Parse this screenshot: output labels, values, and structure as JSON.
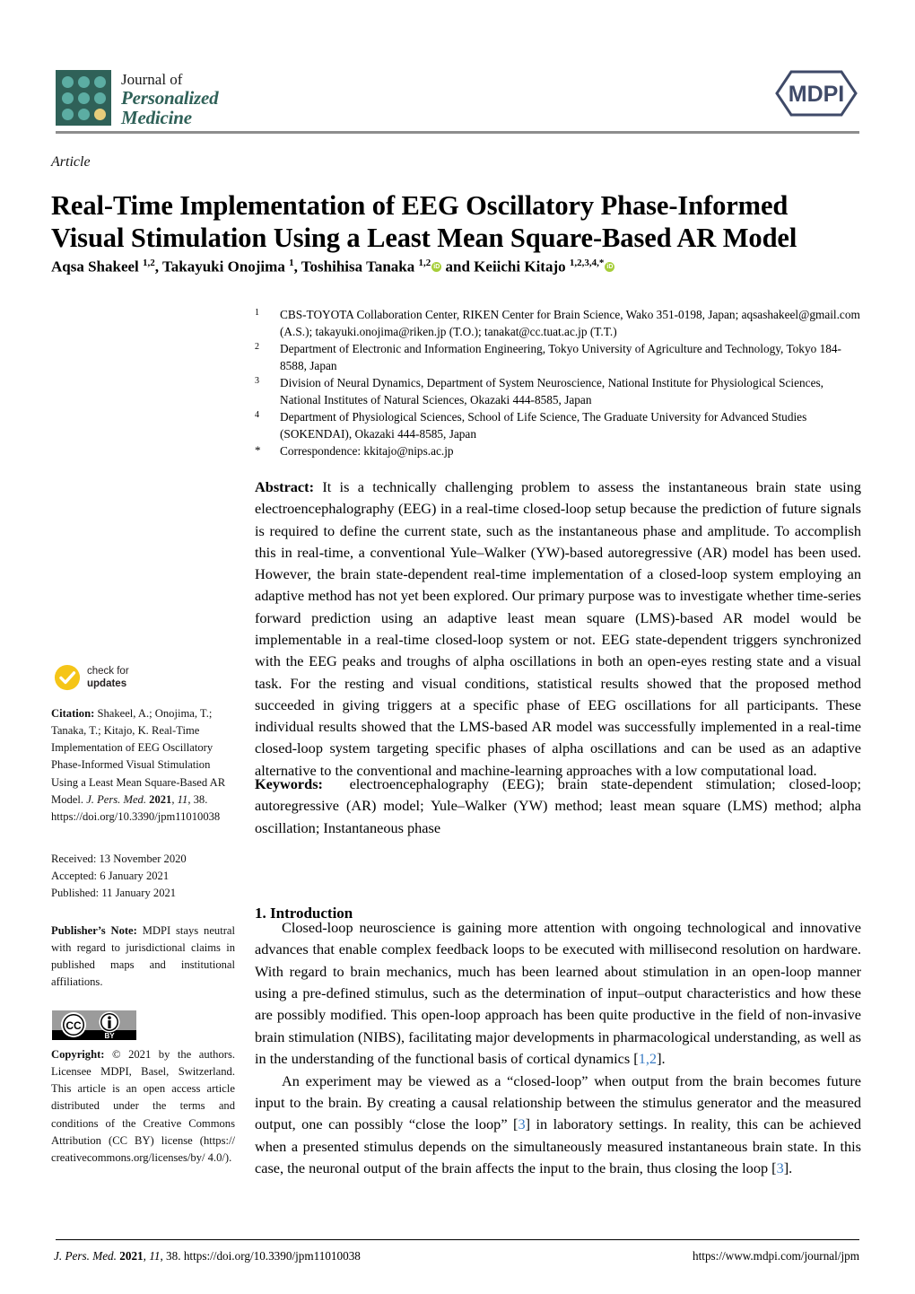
{
  "journal": {
    "logo_line1": "Journal of",
    "logo_line2": "Personalized",
    "logo_line3": "Medicine",
    "publisher_logo_text": "MDPI",
    "logo_square_color": "#2f6158",
    "logo_dot_color": "#5cada3",
    "logo_accent_dot_color": "#e7cd7b",
    "publisher_logo_color": "#3f4a68"
  },
  "article": {
    "type_label": "Article",
    "title": "Real-Time Implementation of EEG Oscillatory Phase-Informed Visual Stimulation Using a Least Mean Square-Based AR Model",
    "authors_html": "Aqsa Shakeel <sup>1,2</sup>, Takayuki Onojima <sup>1</sup>, Toshihisa Tanaka <sup>1,2</sup><span class=\"orcid\">iD</span> and Keiichi Kitajo <sup>1,2,3,4,*</sup><span class=\"orcid\">iD</span>",
    "orcid_color": "#a6ce39"
  },
  "affiliations": [
    {
      "marker": "1",
      "text": "CBS-TOYOTA Collaboration Center, RIKEN Center for Brain Science, Wako 351-0198, Japan; aqsashakeel@gmail.com (A.S.); takayuki.onojima@riken.jp (T.O.); tanakat@cc.tuat.ac.jp (T.T.)"
    },
    {
      "marker": "2",
      "text": "Department of Electronic and Information Engineering, Tokyo University of Agriculture and Technology, Tokyo 184-8588, Japan"
    },
    {
      "marker": "3",
      "text": "Division of Neural Dynamics, Department of System Neuroscience, National Institute for Physiological Sciences, National Institutes of Natural Sciences, Okazaki 444-8585, Japan"
    },
    {
      "marker": "4",
      "text": "Department of Physiological Sciences, School of Life Science, The Graduate University for Advanced Studies (SOKENDAI), Okazaki 444-8585, Japan"
    },
    {
      "marker": "*",
      "text": "Correspondence: kkitajo@nips.ac.jp"
    }
  ],
  "abstract": {
    "label": "Abstract:",
    "text": "It is a technically challenging problem to assess the instantaneous brain state using electroencephalography (EEG) in a real-time closed-loop setup because the prediction of future signals is required to define the current state, such as the instantaneous phase and amplitude. To accomplish this in real-time, a conventional Yule–Walker (YW)-based autoregressive (AR) model has been used. However, the brain state-dependent real-time implementation of a closed-loop system employing an adaptive method has not yet been explored. Our primary purpose was to investigate whether time-series forward prediction using an adaptive least mean square (LMS)-based AR model would be implementable in a real-time closed-loop system or not. EEG state-dependent triggers synchronized with the EEG peaks and troughs of alpha oscillations in both an open-eyes resting state and a visual task. For the resting and visual conditions, statistical results showed that the proposed method succeeded in giving triggers at a specific phase of EEG oscillations for all participants. These individual results showed that the LMS-based AR model was successfully implemented in a real-time closed-loop system targeting specific phases of alpha oscillations and can be used as an adaptive alternative to the conventional and machine-learning approaches with a low computational load."
  },
  "keywords": {
    "label": "Keywords:",
    "text": "electroencephalography (EEG); brain state-dependent stimulation; closed-loop; autoregressive (AR) model; Yule–Walker (YW) method; least mean square (LMS) method; alpha oscillation; Instantaneous phase"
  },
  "rail": {
    "check_for_updates_line1": "check for",
    "check_for_updates_line2": "updates",
    "check_badge_color": "#f5c518",
    "citation_label": "Citation:",
    "citation_text": "Shakeel, A.; Onojima, T.; Tanaka, T.; Kitajo, K. Real-Time Implementation of EEG Oscillatory Phase-Informed Visual Stimulation Using a Least Mean Square-Based AR Model.",
    "citation_journal": "J. Pers. Med.",
    "citation_year": "2021",
    "citation_volume": "11",
    "citation_article": "38.",
    "citation_doi": "https://doi.org/10.3390/jpm11010038",
    "received": "Received: 13 November 2020",
    "accepted": "Accepted: 6 January 2021",
    "published": "Published: 11 January 2021",
    "publisher_note_label": "Publisher’s Note:",
    "publisher_note_text": "MDPI stays neutral with regard to jurisdictional claims in published maps and institutional affiliations.",
    "copyright_label": "Copyright:",
    "copyright_text": "© 2021 by the authors. Licensee MDPI, Basel, Switzerland. This article is an open access article distributed under the terms and conditions of the Creative Commons Attribution (CC BY)  license (https:// creativecommons.org/licenses/by/ 4.0/).",
    "cc_license_text": "BY",
    "cc_mark_text": "CC"
  },
  "body": {
    "section_heading": "1. Introduction",
    "paragraph1_a": "Closed-loop neuroscience is gaining more attention with ongoing technological and innovative advances that enable complex feedback loops to be executed with millisecond resolution on hardware. With regard to brain mechanics, much has been learned about stimulation in an open-loop manner using a pre-defined stimulus, such as the determination of input–output characteristics and how these are possibly modified. This open-loop approach has been quite productive in the field of non-invasive brain stimulation (NIBS), facilitating major developments in pharmacological understanding, as well as in the understanding of the functional basis of cortical dynamics [",
    "paragraph1_ref": "1,2",
    "paragraph1_b": "].",
    "paragraph2_a": "An experiment may be viewed as a “closed-loop” when output from the brain becomes future input to the brain. By creating a causal relationship between the stimulus generator and the measured output, one can possibly “close the loop” [",
    "paragraph2_ref1": "3",
    "paragraph2_b": "] in laboratory settings. In reality, this can be achieved when a presented stimulus depends on the simultaneously measured instantaneous brain state. In this case, the neuronal output of the brain affects the input to the brain, thus closing the loop [",
    "paragraph2_ref2": "3",
    "paragraph2_c": "].",
    "reference_link_color": "#3a7cc4"
  },
  "footer": {
    "left_journal": "J. Pers. Med.",
    "left_year": "2021",
    "left_volume": "11",
    "left_article": "38.",
    "left_doi": "https://doi.org/10.3390/jpm11010038",
    "right_url": "https://www.mdpi.com/journal/jpm"
  }
}
